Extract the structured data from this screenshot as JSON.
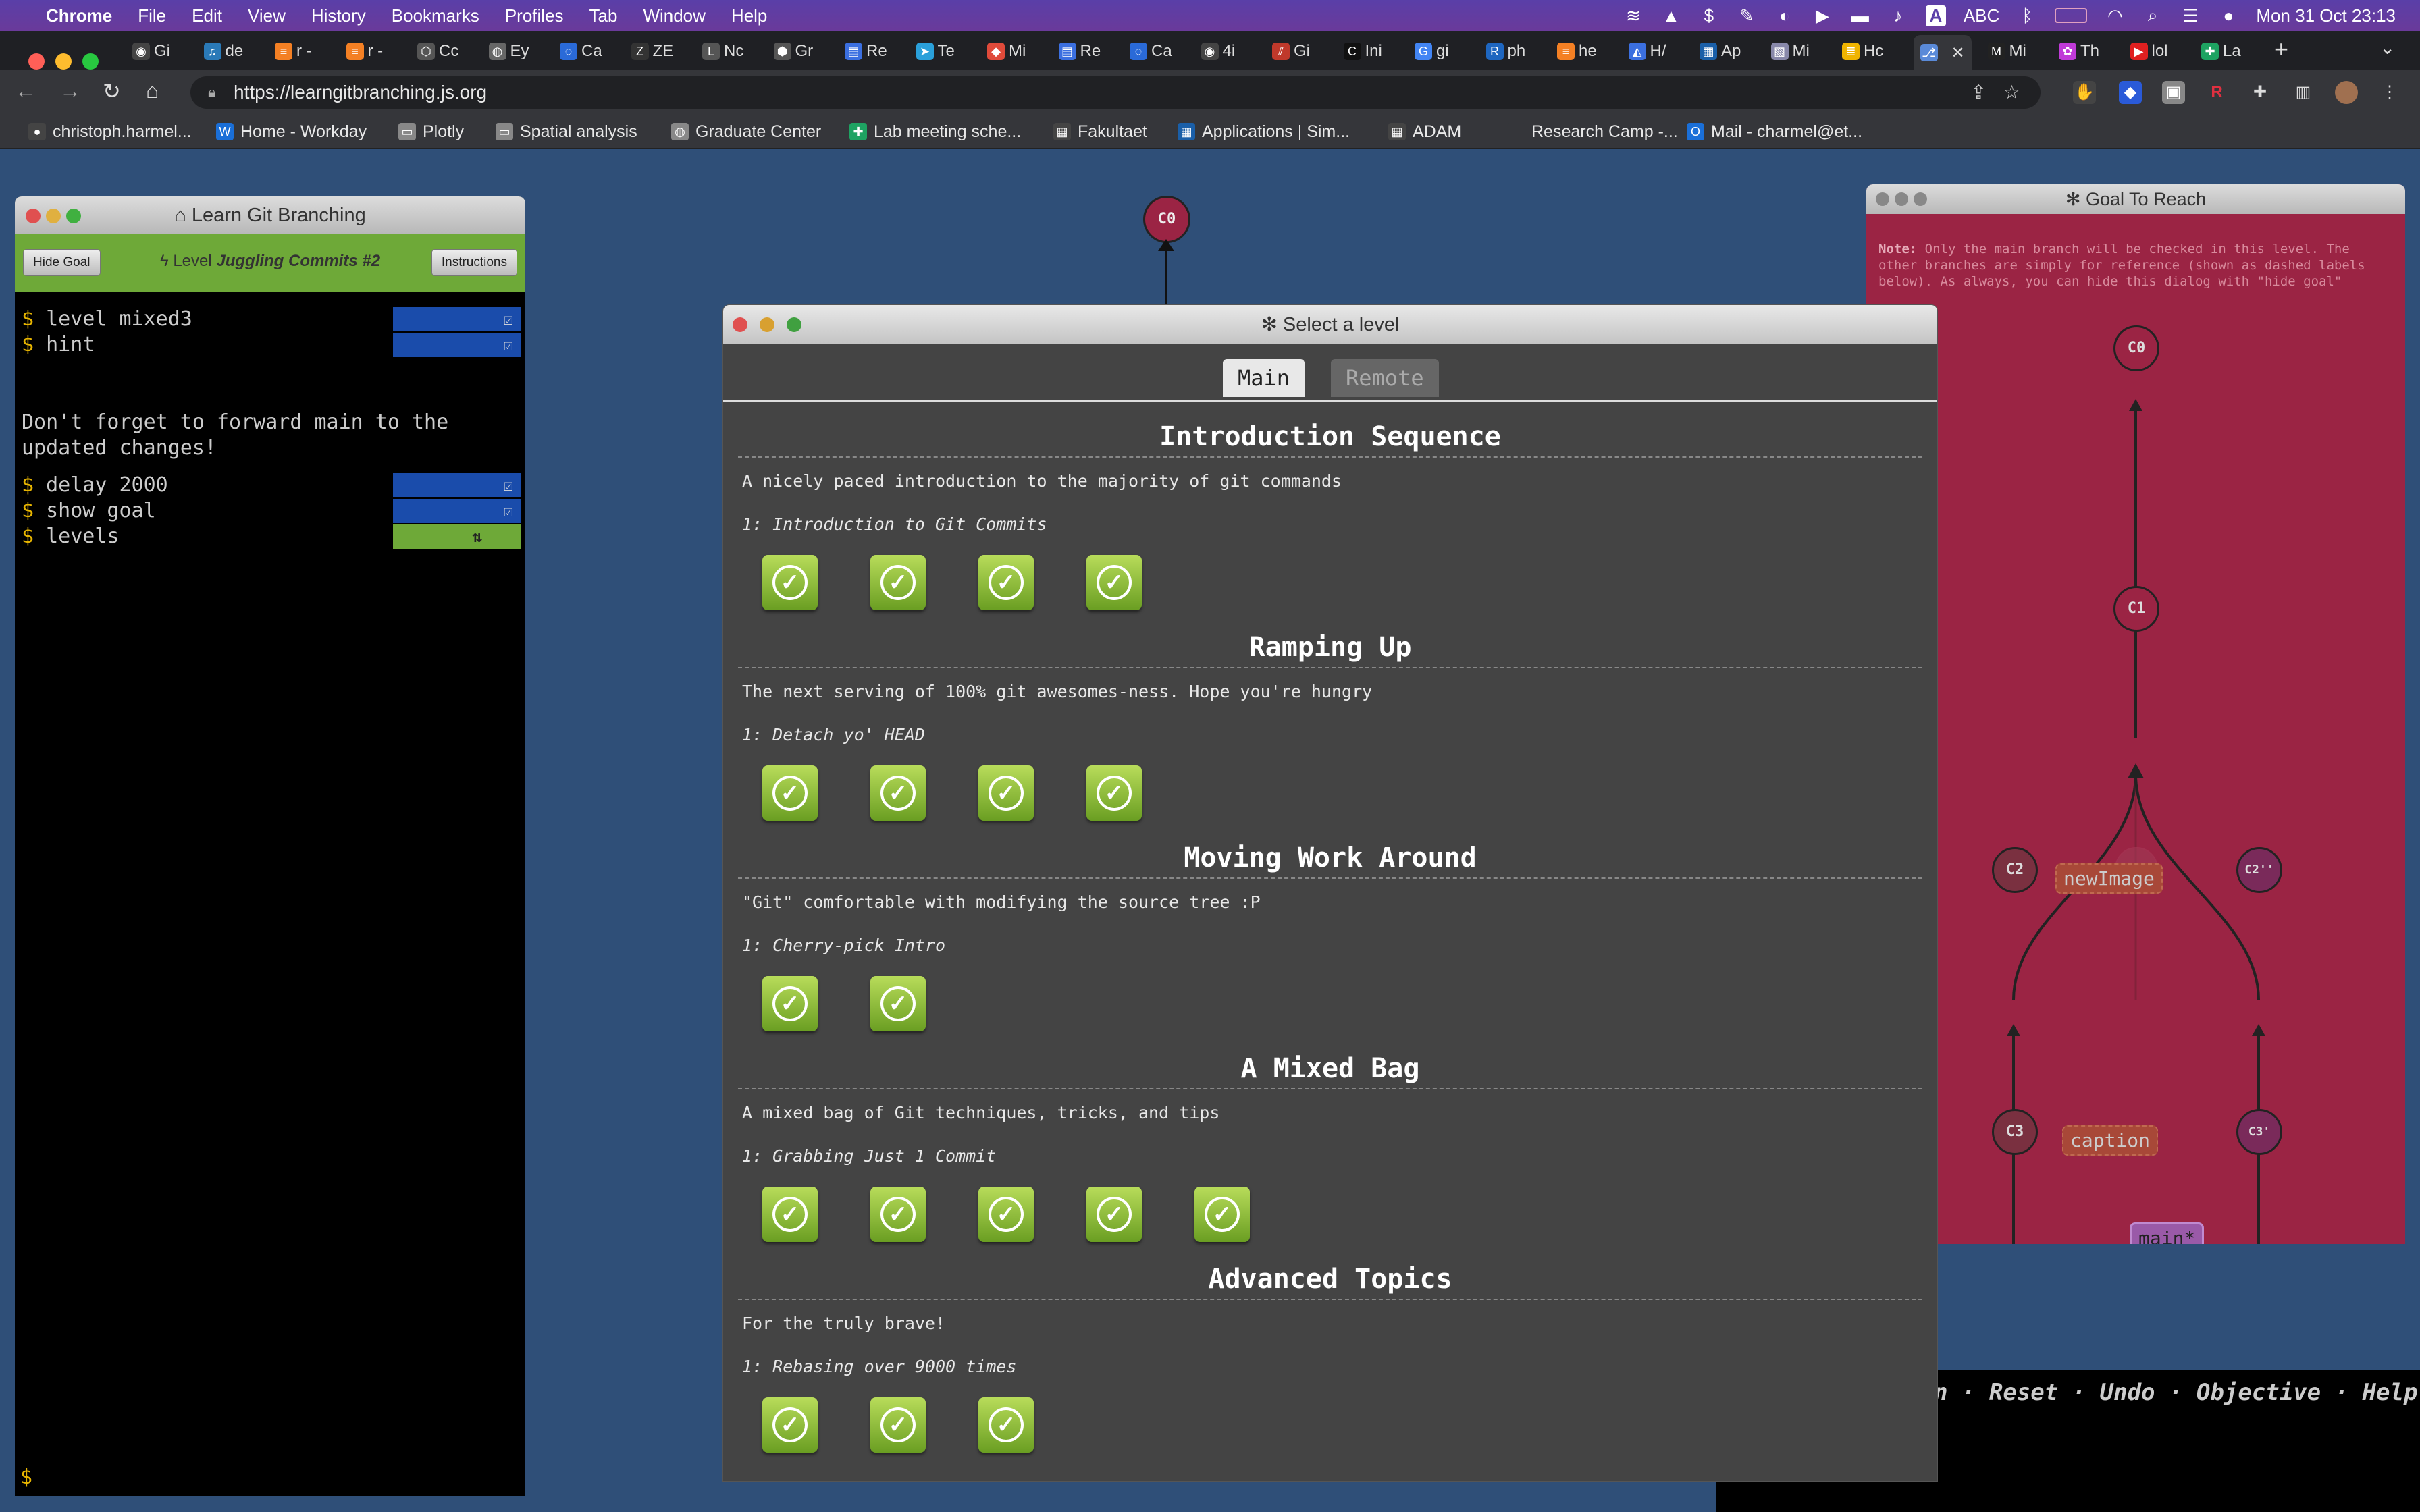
{
  "menubar": {
    "app": "Chrome",
    "items": [
      "File",
      "Edit",
      "View",
      "History",
      "Bookmarks",
      "Profiles",
      "Tab",
      "Window",
      "Help"
    ],
    "input_source": "ABC",
    "datetime": "Mon 31 Oct  23:13"
  },
  "tabs": [
    {
      "title": "Gi",
      "icon": "github-icon",
      "color": "#444"
    },
    {
      "title": "de",
      "icon": "music-icon",
      "color": "#2a7ab8"
    },
    {
      "title": "r -",
      "icon": "stackoverflow-icon",
      "color": "#f48024"
    },
    {
      "title": "r -",
      "icon": "stackoverflow-icon",
      "color": "#f48024"
    },
    {
      "title": "Cc",
      "icon": "hexagon-icon",
      "color": "#555"
    },
    {
      "title": "Ey",
      "icon": "globe-icon",
      "color": "#666"
    },
    {
      "title": "Ca",
      "icon": "spinner-icon",
      "color": "#2a6ad8"
    },
    {
      "title": "ZE",
      "icon": "zotero-icon",
      "color": "#333"
    },
    {
      "title": "Nc",
      "icon": "lph-icon",
      "color": "#555"
    },
    {
      "title": "Gr",
      "icon": "box-icon",
      "color": "#555"
    },
    {
      "title": "Re",
      "icon": "doc-icon",
      "color": "#3b6fe0"
    },
    {
      "title": "Te",
      "icon": "telegram-icon",
      "color": "#2aa0da"
    },
    {
      "title": "Mi",
      "icon": "maps-icon",
      "color": "#e04a3a"
    },
    {
      "title": "Re",
      "icon": "doc-icon",
      "color": "#3b6fe0"
    },
    {
      "title": "Ca",
      "icon": "spinner-icon",
      "color": "#2a6ad8"
    },
    {
      "title": "4i",
      "icon": "github-icon",
      "color": "#444"
    },
    {
      "title": "Gi",
      "icon": "git-icon",
      "color": "#c0392b"
    },
    {
      "title": "Ini",
      "icon": "c-icon",
      "color": "#111"
    },
    {
      "title": "gi",
      "icon": "google-icon",
      "color": "#4285f4"
    },
    {
      "title": "ph",
      "icon": "r-icon",
      "color": "#1e66c0"
    },
    {
      "title": "he",
      "icon": "stackoverflow-icon",
      "color": "#f48024"
    },
    {
      "title": "H/",
      "icon": "chart-icon",
      "color": "#3b6fe0"
    },
    {
      "title": "Ap",
      "icon": "app-icon",
      "color": "#1a5fa8"
    },
    {
      "title": "Mi",
      "icon": "image-icon",
      "color": "#88a"
    },
    {
      "title": "Hc",
      "icon": "stack-icon",
      "color": "#f0b400"
    },
    {
      "title": "",
      "icon": "learngit-icon",
      "color": "#5a8ad8",
      "active": true
    },
    {
      "title": "Mi",
      "icon": "markdown-icon",
      "color": "#222"
    },
    {
      "title": "Th",
      "icon": "paw-icon",
      "color": "#c03ad8"
    },
    {
      "title": "lol",
      "icon": "youtube-icon",
      "color": "#e02020"
    },
    {
      "title": "La",
      "icon": "sheets-icon",
      "color": "#1ea362"
    }
  ],
  "toolbar": {
    "url": "https://learngitbranching.js.org"
  },
  "bookmarks": [
    {
      "label": "christoph.harmel...",
      "icon": "person-icon",
      "color": "#444"
    },
    {
      "label": "Home - Workday",
      "icon": "workday-icon",
      "color": "#1a6fd8"
    },
    {
      "label": "Plotly",
      "icon": "folder-icon",
      "color": "#888"
    },
    {
      "label": "Spatial analysis",
      "icon": "folder-icon",
      "color": "#888"
    },
    {
      "label": "Graduate Center",
      "icon": "globe-icon",
      "color": "#888"
    },
    {
      "label": "Lab meeting sche...",
      "icon": "sheets-icon",
      "color": "#1ea362"
    },
    {
      "label": "Fakultaet",
      "icon": "grid-icon",
      "color": "#444"
    },
    {
      "label": "Applications | Sim...",
      "icon": "app-icon",
      "color": "#1a5fa8"
    },
    {
      "label": "ADAM",
      "icon": "grid-icon",
      "color": "#444"
    },
    {
      "label": "Research Camp -...",
      "icon": "blank-icon",
      "color": "#35363a"
    },
    {
      "label": "Mail - charmel@et...",
      "icon": "outlook-icon",
      "color": "#1a6fd8"
    }
  ],
  "terminal": {
    "title": "Learn Git Branching",
    "hide_goal": "Hide Goal",
    "instructions": "Instructions",
    "level_prefix": "Level",
    "level_name": "Juggling Commits #2",
    "commands": [
      {
        "text": "level mixed3",
        "status": "done"
      },
      {
        "text": "hint",
        "status": "done"
      },
      {
        "text": "delay 2000",
        "status": "done"
      },
      {
        "text": "show goal",
        "status": "done"
      },
      {
        "text": "levels",
        "status": "running"
      }
    ],
    "hint_message": "Don't forget to forward main to the updated changes!",
    "prompt": "$"
  },
  "bg_tree": {
    "node": "C0"
  },
  "goal": {
    "title": "Goal To Reach",
    "note_label": "Note:",
    "note": "Only the main branch will be checked in this level. The other branches are simply for reference (shown as dashed labels below). As always, you can hide this dialog with \"hide goal\"",
    "nodes": [
      "C0",
      "C1",
      "C2",
      "C2'",
      "C2''",
      "C3",
      "C3'"
    ],
    "branches": [
      "newImage",
      "caption",
      "main*"
    ]
  },
  "levels_dialog": {
    "title": "Select a level",
    "tabs": [
      "Main",
      "Remote"
    ],
    "selected_tab": "Main",
    "sections": [
      {
        "title": "Introduction Sequence",
        "about": "A nicely paced introduction to the majority of git commands",
        "first_level": "1: Introduction to Git Commits",
        "levels_completed": 4
      },
      {
        "title": "Ramping Up",
        "about": "The next serving of 100% git awesomes-ness. Hope you're hungry",
        "first_level": "1: Detach yo' HEAD",
        "levels_completed": 4
      },
      {
        "title": "Moving Work Around",
        "about": "\"Git\" comfortable with modifying the source tree :P",
        "first_level": "1: Cherry-pick Intro",
        "levels_completed": 2
      },
      {
        "title": "A Mixed Bag",
        "about": "A mixed bag of Git techniques, tricks, and tips",
        "first_level": "1: Grabbing Just 1 Commit",
        "levels_completed": 5
      },
      {
        "title": "Advanced Topics",
        "about": "For the truly brave!",
        "first_level": "1: Rebasing over 9000 times",
        "levels_completed": 3
      }
    ]
  },
  "bottom_links": {
    "text": "n · Reset · Undo · Objective · Help"
  }
}
